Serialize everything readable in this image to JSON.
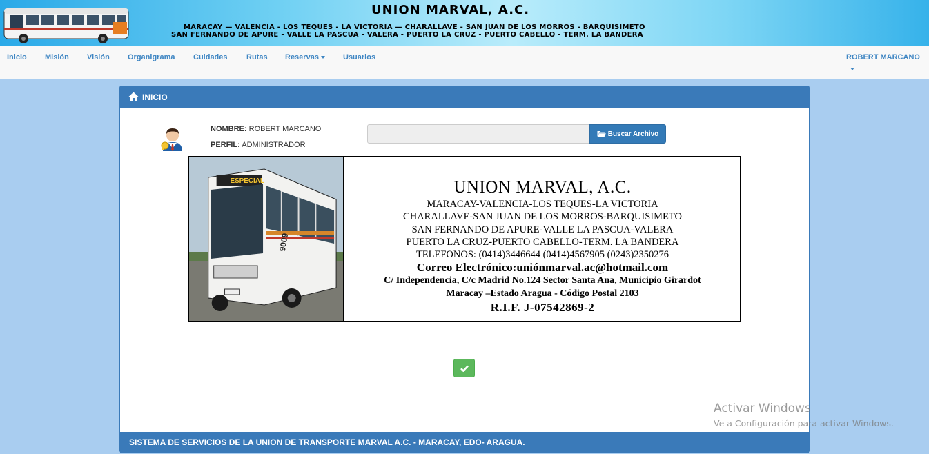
{
  "banner": {
    "title": "UNION MARVAL, A.C.",
    "route_line_1": "MARACAY — VALENCIA - LOS TEQUES - LA VICTORIA — CHARALLAVE - SAN JUAN DE LOS MORROS - BARQUISIMETO",
    "route_line_2": "SAN FERNANDO DE APURE - VALLE  LA PASCUA - VALERA - PUERTO LA CRUZ - PUERTO CABELLO - TERM. LA BANDERA"
  },
  "navbar": {
    "items": [
      "Inicio",
      "Misión",
      "Visión",
      "Organigrama",
      "Cuidades",
      "Rutas",
      "Reservas",
      "Usuarios"
    ],
    "user": "ROBERT MARCANO"
  },
  "panel": {
    "heading": "INICIO",
    "nombre_label": "NOMBRE:",
    "nombre_value": "ROBERT MARCANO",
    "perfil_label": "PERFIL:",
    "perfil_value": "ADMINISTRADOR",
    "file_button": "Buscar Archivo",
    "footer": "SISTEMA DE SERVICIOS DE LA UNION DE TRANSPORTE MARVAL A.C. - MARACAY, EDO- ARAGUA."
  },
  "letterhead": {
    "bus_sign": "ESPECIAL",
    "bus_number": "9009",
    "title": "UNION MARVAL, A.C.",
    "line1": "MARACAY-VALENCIA-LOS TEQUES-LA VICTORIA",
    "line2": "CHARALLAVE-SAN JUAN DE LOS MORROS-BARQUISIMETO",
    "line3": "SAN FERNANDO DE APURE-VALLE  LA PASCUA-VALERA",
    "line4": "PUERTO LA CRUZ-PUERTO CABELLO-TERM. LA BANDERA",
    "phones": "TELEFONOS:  (0414)3446644   (0414)4567905   (0243)2350276",
    "email": "Correo Electrónico:uniónmarval.ac@hotmail.com",
    "address1": "C/ Independencia,  C/c Madrid No.124 Sector Santa Ana, Municipio  Girardot",
    "address2": "Maracay –Estado Aragua - Código Postal 2103",
    "rif": "R.I.F. J-07542869-2"
  },
  "watermark": {
    "title": "Activar Windows",
    "subtitle": "Ve a Configuración para activar Windows."
  },
  "colors": {
    "primary": "#3a7ab9",
    "nav_link": "#3f86c3",
    "success": "#5cb85c",
    "page_background": "#a9cdf0"
  },
  "icons": {
    "home": "home-icon",
    "avatar": "user-avatar-icon",
    "folder": "folder-open-icon",
    "check": "check-icon"
  }
}
